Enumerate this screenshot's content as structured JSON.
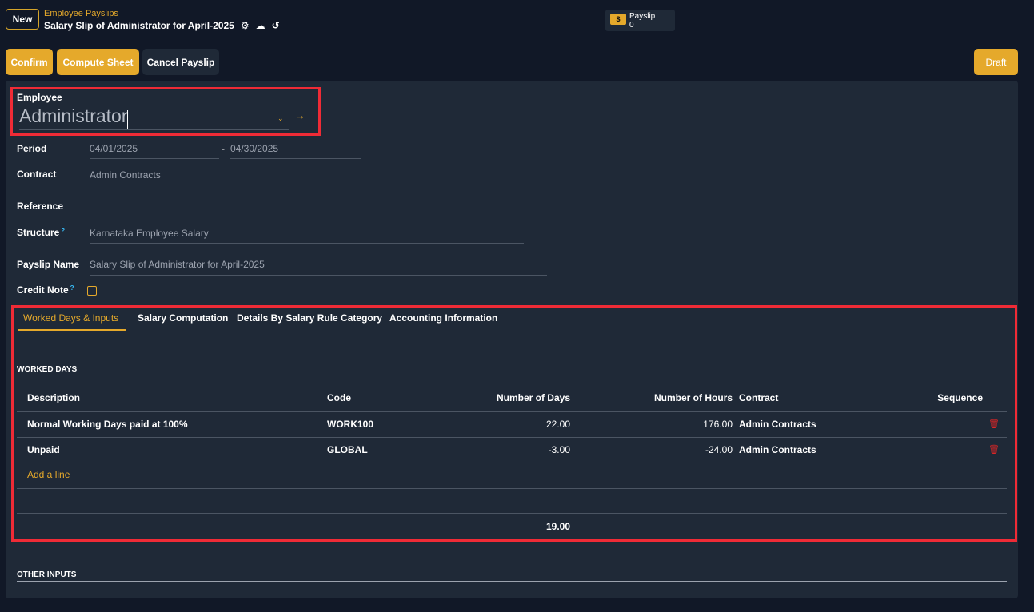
{
  "breadcrumb": {
    "new_label": "New",
    "parent": "Employee Payslips",
    "title": "Salary Slip of Administrator for April-2025"
  },
  "stat_button": {
    "label": "Payslip",
    "count": "0"
  },
  "actions": {
    "confirm": "Confirm",
    "compute": "Compute Sheet",
    "cancel": "Cancel Payslip",
    "status": "Draft"
  },
  "form": {
    "employee_label": "Employee",
    "employee_value": "Administrator",
    "period_label": "Period",
    "period_start": "04/01/2025",
    "period_sep": "-",
    "period_end": "04/30/2025",
    "contract_label": "Contract",
    "contract_value": "Admin Contracts",
    "reference_label": "Reference",
    "reference_value": "",
    "structure_label": "Structure",
    "structure_value": "Karnataka Employee Salary",
    "payslip_name_label": "Payslip Name",
    "payslip_name_value": "Salary Slip of Administrator for April-2025",
    "credit_note_label": "Credit Note",
    "help_mark": "?"
  },
  "tabs": [
    {
      "label": "Worked Days & Inputs"
    },
    {
      "label": "Salary Computation"
    },
    {
      "label": "Details By Salary Rule Category"
    },
    {
      "label": "Accounting Information"
    }
  ],
  "worked_days": {
    "section_title": "WORKED DAYS",
    "columns": [
      "Description",
      "Code",
      "Number of Days",
      "Number of Hours",
      "Contract",
      "Sequence"
    ],
    "rows": [
      {
        "description": "Normal Working Days paid at 100%",
        "code": "WORK100",
        "days": "22.00",
        "hours": "176.00",
        "contract": "Admin Contracts"
      },
      {
        "description": "Unpaid",
        "code": "GLOBAL",
        "days": "-3.00",
        "hours": "-24.00",
        "contract": "Admin Contracts"
      }
    ],
    "add_line": "Add a line",
    "total_days": "19.00"
  },
  "other_inputs": {
    "section_title": "OTHER INPUTS"
  },
  "colors": {
    "accent": "#e5a92b",
    "highlight": "#ef2b36",
    "background": "#111827",
    "sheet": "#1f2937"
  },
  "icons": [
    "gear-icon",
    "cloud-upload-icon",
    "undo-icon",
    "money-icon",
    "dropdown-caret-icon",
    "arrow-right-icon",
    "trash-icon"
  ]
}
